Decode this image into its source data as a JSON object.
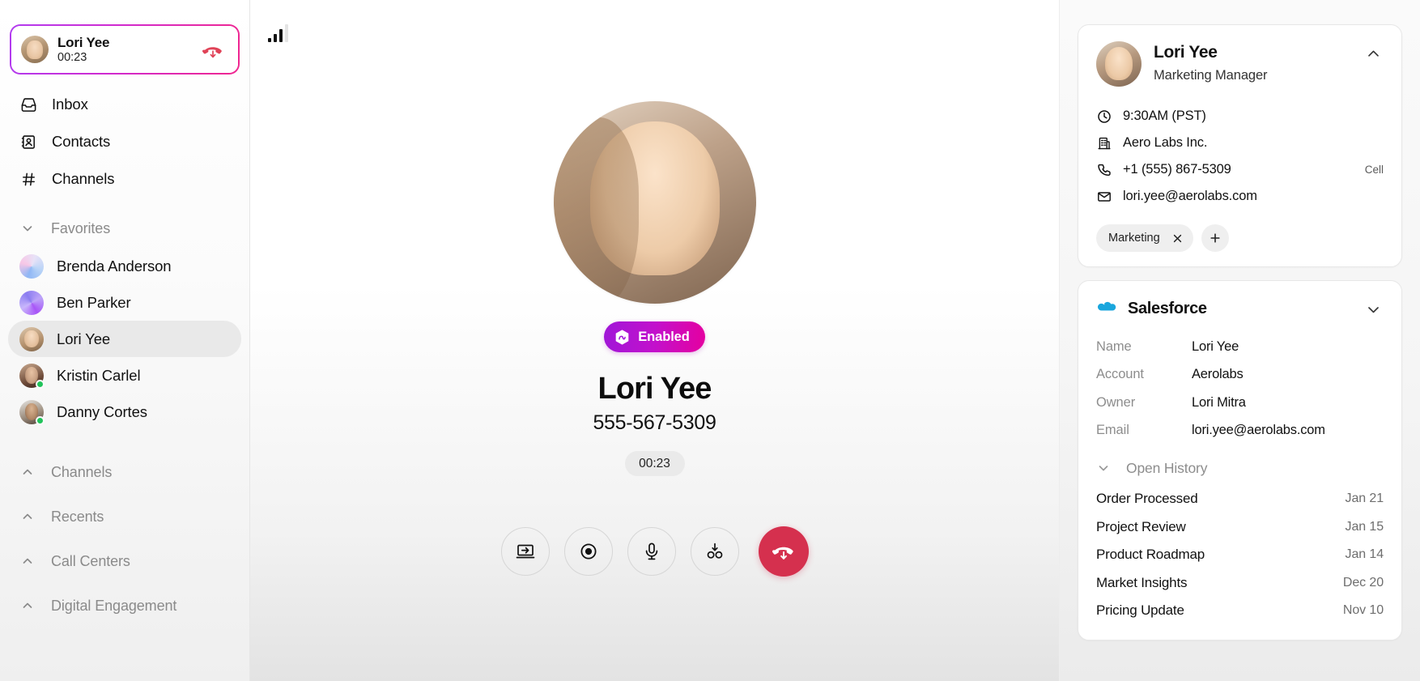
{
  "sidebar": {
    "active_call": {
      "name": "Lori Yee",
      "duration": "00:23",
      "end_icon": "hangup-icon",
      "avatar": "avatar-lori-yee"
    },
    "nav": [
      {
        "label": "Inbox",
        "icon": "inbox-icon"
      },
      {
        "label": "Contacts",
        "icon": "contacts-icon"
      },
      {
        "label": "Channels",
        "icon": "hash-icon"
      }
    ],
    "favorites": {
      "title": "Favorites",
      "chevron": "chevron-down-icon",
      "items": [
        {
          "name": "Brenda Anderson",
          "avatar_style": "gradient-a",
          "online": false
        },
        {
          "name": "Ben Parker",
          "avatar_style": "gradient-b",
          "online": false
        },
        {
          "name": "Lori Yee",
          "avatar_style": "photo-1",
          "online": false,
          "active": true
        },
        {
          "name": "Kristin Carlel",
          "avatar_style": "photo-2",
          "online": true
        },
        {
          "name": "Danny Cortes",
          "avatar_style": "photo-3",
          "online": true
        }
      ]
    },
    "sections": [
      {
        "label": "Channels",
        "chevron": "chevron-up-icon"
      },
      {
        "label": "Recents",
        "chevron": "chevron-up-icon"
      },
      {
        "label": "Call Centers",
        "chevron": "chevron-up-icon"
      },
      {
        "label": "Digital Engagement",
        "chevron": "chevron-up-icon"
      }
    ]
  },
  "center": {
    "signal_icon": "signal-bars-icon",
    "signal_bars_filled": 3,
    "signal_bars_total": 4,
    "avatar": "avatar-lori-yee-large",
    "ai_badge": {
      "label": "Enabled",
      "icon": "ai-hex-icon",
      "gradient_from": "#a016d8",
      "gradient_to": "#e5009f"
    },
    "name": "Lori Yee",
    "number": "555-567-5309",
    "timer": "00:23",
    "controls": [
      {
        "name": "transfer-call-button",
        "icon": "screen-transfer-icon"
      },
      {
        "name": "record-call-button",
        "icon": "record-icon"
      },
      {
        "name": "mute-button",
        "icon": "microphone-icon"
      },
      {
        "name": "merge-call-button",
        "icon": "merge-call-icon"
      },
      {
        "name": "end-call-button",
        "icon": "hangup-icon",
        "color": "#d5304e"
      }
    ]
  },
  "right_panel": {
    "contact": {
      "name": "Lori Yee",
      "role": "Marketing Manager",
      "collapse_icon": "chevron-up-icon",
      "avatar": "avatar-lori-yee",
      "details": [
        {
          "icon": "clock-icon",
          "text": "9:30AM (PST)",
          "meta": ""
        },
        {
          "icon": "building-icon",
          "text": "Aero Labs Inc.",
          "meta": ""
        },
        {
          "icon": "phone-icon",
          "text": "+1 (555) 867-5309",
          "meta": "Cell"
        },
        {
          "icon": "mail-icon",
          "text": "lori.yee@aerolabs.com",
          "meta": ""
        }
      ],
      "tags": [
        {
          "label": "Marketing",
          "remove_icon": "close-icon"
        }
      ],
      "add_tag_icon": "plus-icon"
    },
    "salesforce": {
      "title": "Salesforce",
      "icon": "salesforce-cloud-icon",
      "icon_color": "#19a6dd",
      "collapse_icon": "chevron-down-icon",
      "fields": [
        {
          "key": "Name",
          "value": "Lori Yee"
        },
        {
          "key": "Account",
          "value": "Aerolabs"
        },
        {
          "key": "Owner",
          "value": "Lori Mitra"
        },
        {
          "key": "Email",
          "value": "lori.yee@aerolabs.com"
        }
      ],
      "history": {
        "title": "Open History",
        "chevron": "chevron-down-icon",
        "items": [
          {
            "name": "Order Processed",
            "date": "Jan 21"
          },
          {
            "name": "Project Review",
            "date": "Jan 15"
          },
          {
            "name": "Product Roadmap",
            "date": "Jan 14"
          },
          {
            "name": "Market Insights",
            "date": "Dec 20"
          },
          {
            "name": "Pricing Update",
            "date": "Nov 10"
          }
        ]
      }
    }
  }
}
